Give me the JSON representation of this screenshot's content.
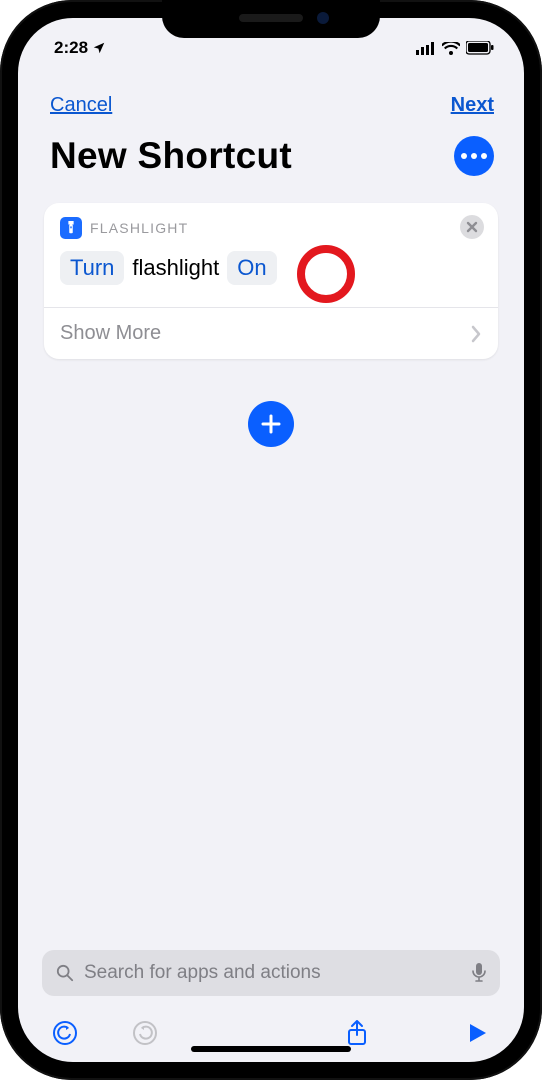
{
  "status": {
    "time": "2:28",
    "location_arrow": "➤"
  },
  "nav": {
    "cancel": "Cancel",
    "next": "Next"
  },
  "title": "New Shortcut",
  "action": {
    "app_label": "FLASHLIGHT",
    "verb": "Turn",
    "subject": "flashlight",
    "state": "On",
    "show_more": "Show More"
  },
  "search": {
    "placeholder": "Search for apps and actions"
  }
}
